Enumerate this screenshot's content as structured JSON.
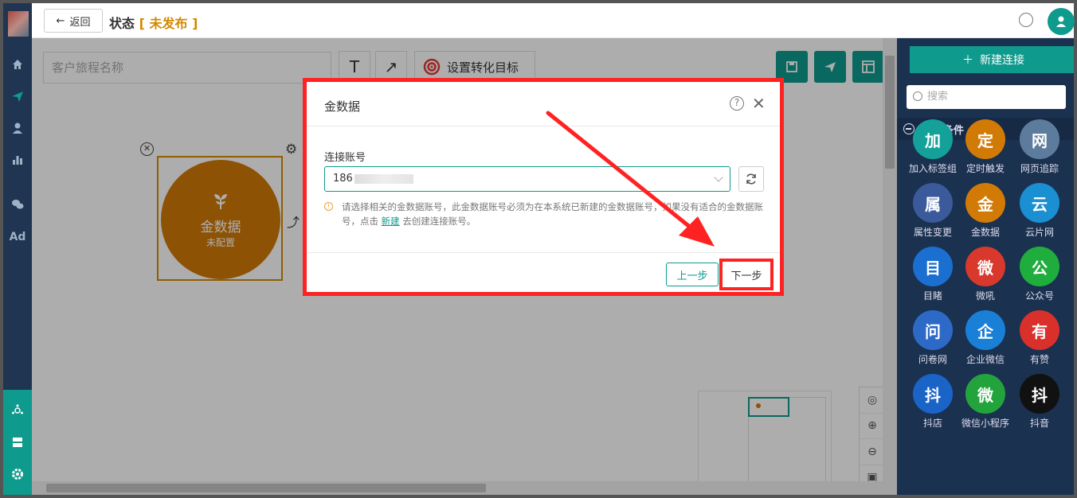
{
  "topbar": {
    "back_label": "返回",
    "title": "状态",
    "status": "未发布"
  },
  "canvas": {
    "journey_placeholder": "客户旅程名称",
    "text_tool": "T",
    "arrow_tool": "↗",
    "goal_label": "设置转化目标",
    "node": {
      "name": "金数据",
      "status": "未配置"
    }
  },
  "sidebar_left": {
    "ad_label": "Ad"
  },
  "rightpanel": {
    "new_connection": "新建连接",
    "search_placeholder": "搜索",
    "section_title": "触发条件",
    "tiles": [
      {
        "label": "加入标签组",
        "color": "#14a19a",
        "icon": "user-plus-icon"
      },
      {
        "label": "定时触发",
        "color": "#d27a06",
        "icon": "clock-icon"
      },
      {
        "label": "网页追踪",
        "color": "#5d7b9c",
        "icon": "webpage-icon"
      },
      {
        "label": "属性变更",
        "color": "#3a5a9b",
        "icon": "edit-icon"
      },
      {
        "label": "金数据",
        "color": "#d27a06",
        "icon": "jinshuju-icon"
      },
      {
        "label": "云片网",
        "color": "#1a8fd1",
        "icon": "yunpian-icon"
      },
      {
        "label": "目睹",
        "color": "#1a6fd1",
        "icon": "play-icon"
      },
      {
        "label": "微吼",
        "color": "#d9382c",
        "icon": "weihou-icon"
      },
      {
        "label": "公众号",
        "color": "#1fad3e",
        "icon": "wechat-icon"
      },
      {
        "label": "问卷网",
        "color": "#2d6ac8",
        "icon": "wenjuan-icon"
      },
      {
        "label": "企业微信",
        "color": "#1a7fd6",
        "icon": "wecom-icon"
      },
      {
        "label": "有赞",
        "color": "#d9302c",
        "icon": "youzan-icon"
      },
      {
        "label": "抖店",
        "color": "#1a64c8",
        "icon": "doudian-icon"
      },
      {
        "label": "微信小程序",
        "color": "#23a33c",
        "icon": "miniprogram-icon"
      },
      {
        "label": "抖音",
        "color": "#111111",
        "icon": "douyin-icon"
      }
    ]
  },
  "modal": {
    "title": "金数据",
    "account_label": "连接账号",
    "account_value": "186",
    "tip_text": "请选择相关的金数据账号，此金数据账号必须为在本系统已新建的金数据账号，如果没有适合的金数据账号，点击",
    "tip_link": "新建",
    "tip_suffix": "去创建连接账号。",
    "prev_label": "上一步",
    "next_label": "下一步"
  },
  "colors": {
    "accent": "#0e9a8c",
    "node_orange": "#d27a06",
    "status_orange": "#d48900",
    "annotation_red": "#ff2222",
    "nav_dark": "#1f3551"
  }
}
